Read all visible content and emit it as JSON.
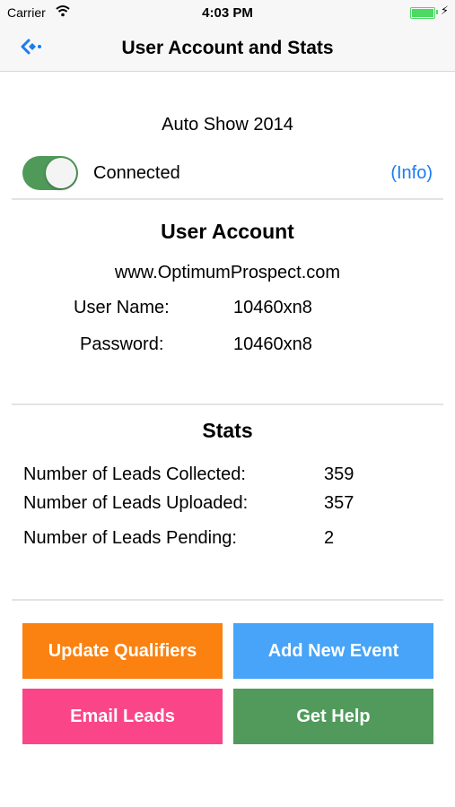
{
  "status": {
    "carrier": "Carrier",
    "time": "4:03 PM"
  },
  "nav": {
    "title": "User Account and Stats",
    "back_icon": "back-arrow-icon"
  },
  "event": {
    "name": "Auto Show 2014"
  },
  "connection": {
    "toggle_on": true,
    "status_label": "Connected",
    "info_link": "(Info)"
  },
  "account": {
    "title": "User Account",
    "website": "www.OptimumProspect.com",
    "username_label": "User Name:",
    "username": "10460xn8",
    "password_label": "Password:",
    "password": "10460xn8"
  },
  "stats": {
    "title": "Stats",
    "collected_label": "Number of Leads Collected:",
    "collected": "359",
    "uploaded_label": "Number of Leads Uploaded:",
    "uploaded": "357",
    "pending_label": "Number of Leads Pending:",
    "pending": "2"
  },
  "buttons": {
    "update_qualifiers": "Update Qualifiers",
    "add_new_event": "Add New Event",
    "email_leads": "Email Leads",
    "get_help": "Get Help"
  },
  "colors": {
    "accent": "#1a7cf0",
    "toggle_on": "#4f9a59",
    "update_qualifiers": "#fb8110",
    "add_new_event": "#47a4f8",
    "email_leads": "#fa4688",
    "get_help": "#519a5c"
  }
}
